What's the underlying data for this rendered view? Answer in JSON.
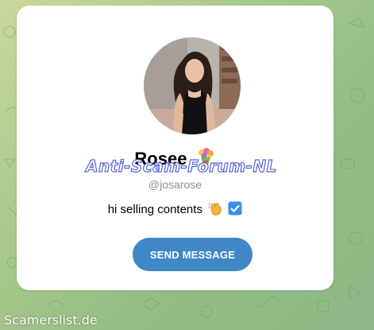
{
  "profile": {
    "name": "Rosee",
    "username": "@josarose",
    "bio": "hi selling contents"
  },
  "actions": {
    "send_message_label": "SEND MESSAGE"
  },
  "watermarks": {
    "overlay": "Anti-Scam-Forum-NL",
    "footer": "Scamerslist.de"
  },
  "icons": {
    "name": "bouquet-icon",
    "bio": [
      "waving-hand-icon",
      "check-box-icon"
    ]
  },
  "colors": {
    "button": "#3f88c5",
    "watermark_stroke": "#5b63d6",
    "username": "#8a8f96"
  }
}
